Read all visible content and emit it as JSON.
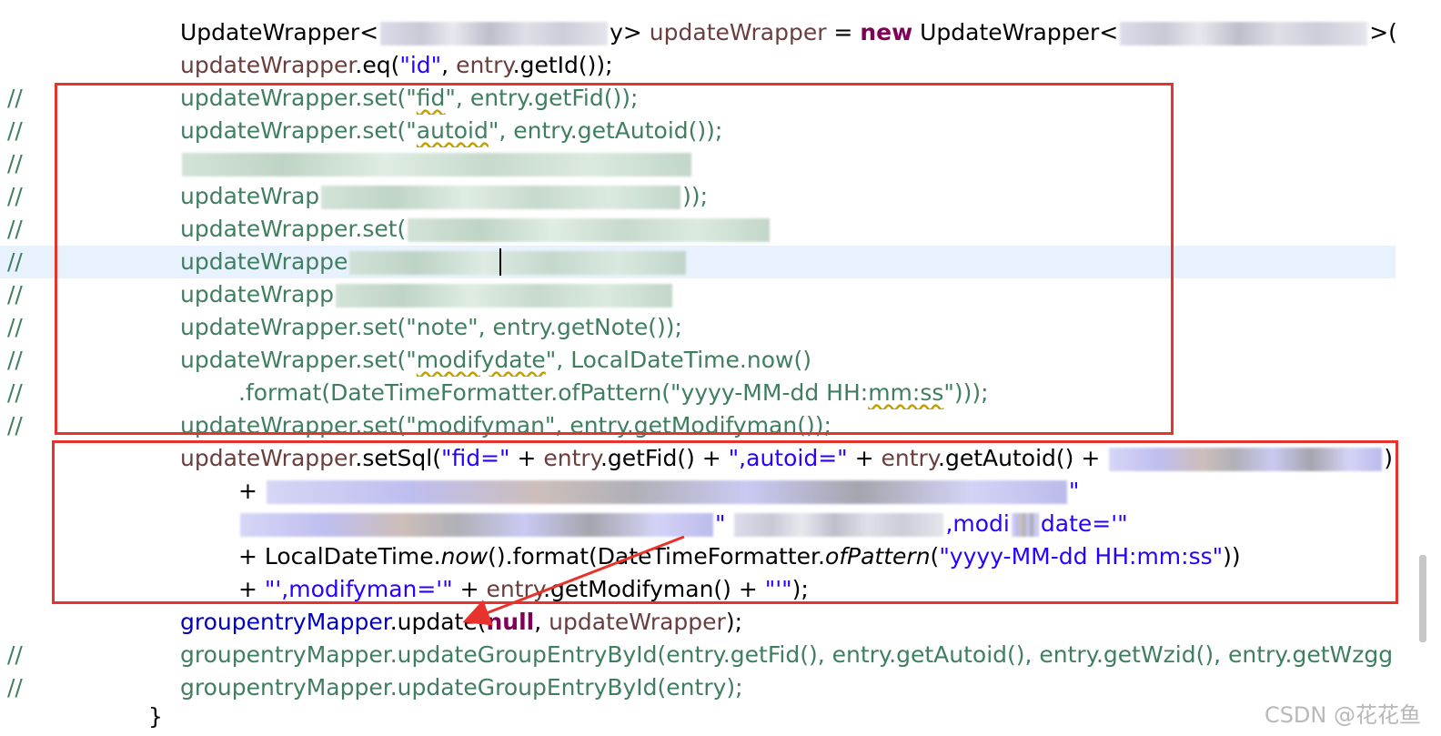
{
  "comment_marker": "//",
  "lines": {
    "l1": {
      "a": "UpdateWrapper<",
      "b": "y> ",
      "c": "updateWrapper",
      "d": " = ",
      "e": "new",
      "f": " UpdateWrapper<",
      "g": ">();"
    },
    "l2": {
      "a": "updateWrapper",
      "b": ".eq(",
      "c": "\"id\"",
      "d": ", ",
      "e": "entry",
      "f": ".getId());"
    },
    "l3": {
      "a": "updateWrapper.set(\"",
      "b": "fid",
      "c": "\", entry.getFid());"
    },
    "l4": {
      "a": "updateWrapper.set(\"",
      "b": "autoid",
      "c": "\", entry.getAutoid());"
    },
    "l6": {
      "a": "updateWrap",
      "b": "));"
    },
    "l7": {
      "a": "updateWrapper.set("
    },
    "l8": {
      "a": "updateWrappe"
    },
    "l9": {
      "a": "updateWrapp"
    },
    "l10": {
      "a": "updateWrapper.set(\"note\", entry.getNote());"
    },
    "l11": {
      "a": "updateWrapper.set(\"",
      "b": "modifydate",
      "c": "\",  LocalDateTime.now()"
    },
    "l12": {
      "a": ".format(DateTimeFormatter.ofPattern(\"yyyy-MM-dd HH:",
      "b": "mm:ss",
      "c": "\")));"
    },
    "l13": {
      "a": "updateWrapper.set(\"modifyman\", entry.getModifyman());"
    },
    "l14": {
      "a": "updateWrapper",
      "b": ".setSql(",
      "c": "\"fid=\"",
      "d": " + ",
      "e": "entry",
      "f": ".getFid() + ",
      "g": "\",autoid=\"",
      "h": " + ",
      "i": "entry",
      "j": ".getAutoid() + ",
      "k": ")"
    },
    "l15": {
      "a": "+ ",
      "b": "\""
    },
    "l16": {
      "a": "\" ",
      "b": ",modi",
      "c": "date='\""
    },
    "l17": {
      "a": "+ LocalDateTime.",
      "b": "now",
      "c": "().format(DateTimeFormatter.",
      "d": "ofPattern",
      "e": "(",
      "f": "\"yyyy-MM-dd HH:mm:ss\"",
      "g": "))"
    },
    "l18": {
      "a": "+ ",
      "b": "\"',modifyman='\"",
      "c": " + ",
      "d": "entry",
      "e": ".getModifyman() + ",
      "f": "\"'\"",
      "g": ");"
    },
    "l19": {
      "a": "groupentryMapper",
      "b": ".update(",
      "c": "null",
      "d": ", ",
      "e": "updateWrapper",
      "f": ");"
    },
    "l20": {
      "a": "groupentryMapper.updateGroupEntryById(entry.getFid(), entry.getAutoid(), entry.getWzid(), entry.getWzgg"
    },
    "l21": {
      "a": "groupentryMapper.updateGroupEntryById(entry);"
    },
    "l22": {
      "a": "}"
    }
  },
  "watermark": "CSDN @花花鱼",
  "annotation_color": "#e8322c"
}
